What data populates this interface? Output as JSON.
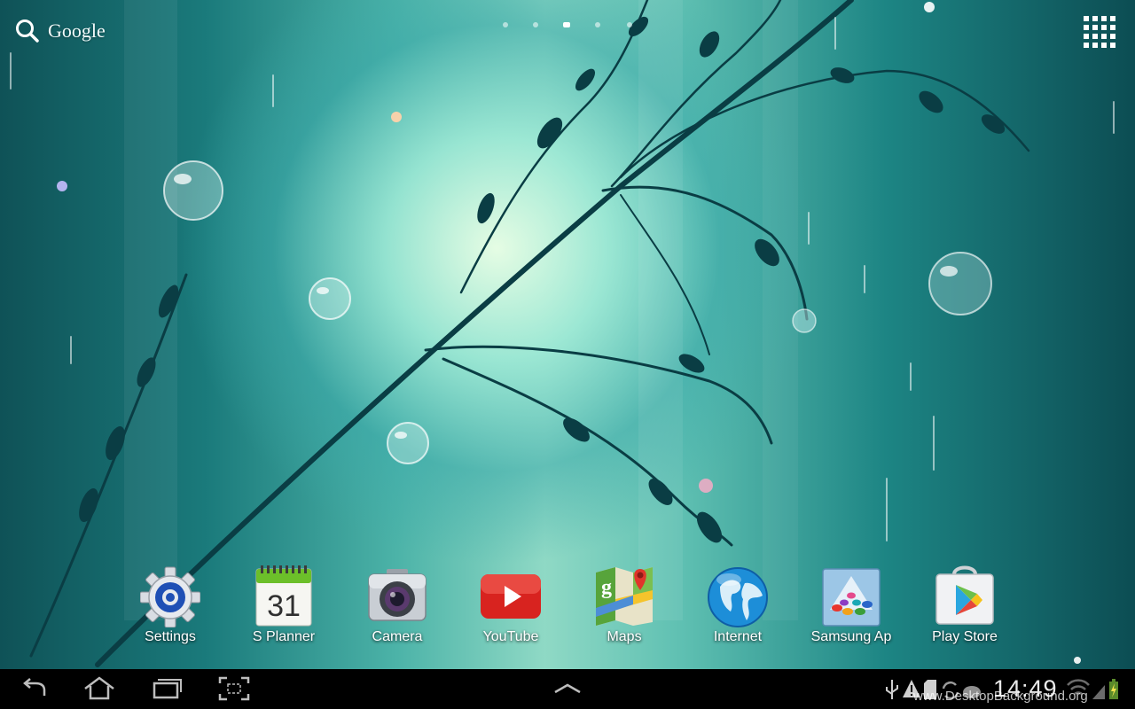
{
  "search": {
    "label": "Google",
    "icon": "search-icon"
  },
  "home_pages": {
    "count": 5,
    "active_index": 2
  },
  "apps_button": {
    "icon": "apps-grid-icon"
  },
  "dock": [
    {
      "label": "Settings",
      "icon": "settings-gear-icon"
    },
    {
      "label": "S Planner",
      "icon": "calendar-icon",
      "icon_text": "31"
    },
    {
      "label": "Camera",
      "icon": "camera-icon"
    },
    {
      "label": "YouTube",
      "icon": "youtube-icon"
    },
    {
      "label": "Maps",
      "icon": "maps-icon"
    },
    {
      "label": "Internet",
      "icon": "globe-icon"
    },
    {
      "label": "Samsung Ap",
      "icon": "samsung-apps-icon"
    },
    {
      "label": "Play Store",
      "icon": "play-store-icon"
    }
  ],
  "navbar": {
    "buttons": [
      "back-icon",
      "home-icon",
      "recent-apps-icon",
      "screenshot-icon",
      "expand-up-icon"
    ],
    "clock": "14:49",
    "status_icons": [
      "usb-icon",
      "warning-icon",
      "sd-card-icon",
      "sync-icon",
      "wifi-icon",
      "signal-icon",
      "battery-charging-icon"
    ]
  },
  "watermark": "www.DesktopBackground.org",
  "colors": {
    "navbar": "#000000",
    "wallpaper_center": "#c8f5e2",
    "wallpaper_edge": "#0f5257"
  }
}
